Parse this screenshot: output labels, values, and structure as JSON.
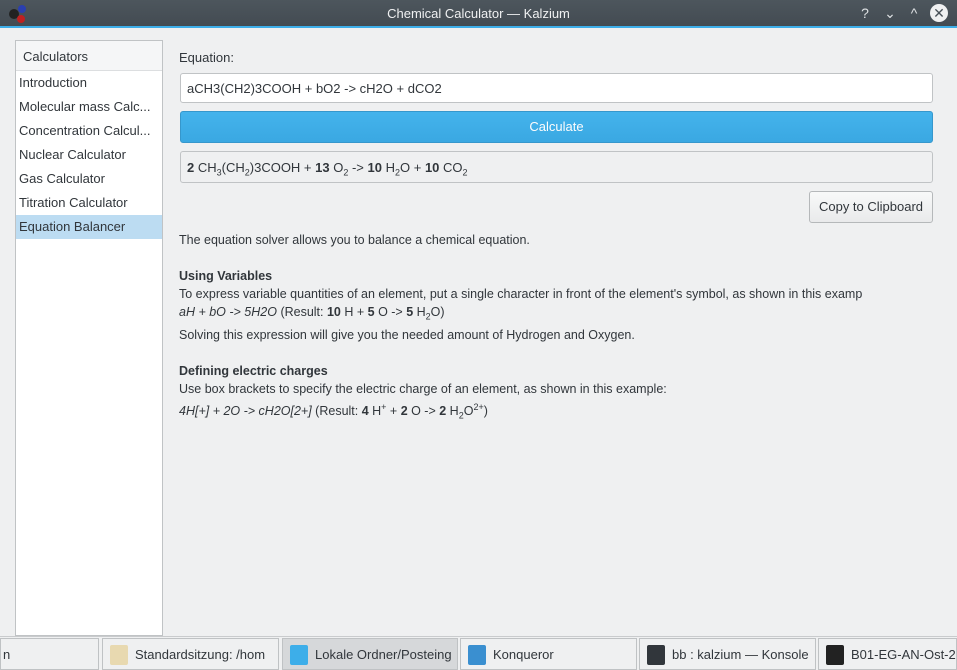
{
  "window": {
    "title": "Chemical Calculator — Kalzium",
    "buttons": [
      "?",
      "⌄",
      "^",
      "✕"
    ]
  },
  "sidebar": {
    "header": "Calculators",
    "items": [
      {
        "label": "Introduction"
      },
      {
        "label": "Molecular mass Calc..."
      },
      {
        "label": "Concentration Calcul..."
      },
      {
        "label": "Nuclear Calculator"
      },
      {
        "label": "Gas Calculator"
      },
      {
        "label": "Titration Calculator"
      },
      {
        "label": "Equation Balancer",
        "selected": true
      }
    ]
  },
  "main": {
    "equation_label": "Equation:",
    "equation_value": "aCH3(CH2)3COOH + bO2 -> cH2O + dCO2",
    "calculate_label": "Calculate",
    "result": [
      {
        "t": "2",
        "b": 1
      },
      {
        "t": " CH"
      },
      {
        "t": "3",
        "sub": 1
      },
      {
        "t": "(CH"
      },
      {
        "t": "2",
        "sub": 1
      },
      {
        "t": ")3COOH + "
      },
      {
        "t": "13",
        "b": 1
      },
      {
        "t": " O"
      },
      {
        "t": "2",
        "sub": 1
      },
      {
        "t": " -> "
      },
      {
        "t": "10",
        "b": 1
      },
      {
        "t": " H"
      },
      {
        "t": "2",
        "sub": 1
      },
      {
        "t": "O + "
      },
      {
        "t": "10",
        "b": 1
      },
      {
        "t": " CO"
      },
      {
        "t": "2",
        "sub": 1
      }
    ],
    "copy_label": "Copy to Clipboard",
    "help": [
      [
        {
          "t": "The equation solver allows you to balance a chemical equation."
        }
      ],
      null,
      [
        {
          "t": "Using Variables",
          "b": 1
        }
      ],
      [
        {
          "t": "To express variable quantities of an element, put a single character in front of the element's symbol, as shown in this examp"
        }
      ],
      [
        {
          "t": "aH + bO -> 5H2O",
          "i": 1
        },
        {
          "t": " (Result: "
        },
        {
          "t": "10",
          "b": 1
        },
        {
          "t": " H + "
        },
        {
          "t": "5",
          "b": 1
        },
        {
          "t": " O -> "
        },
        {
          "t": "5",
          "b": 1
        },
        {
          "t": " H"
        },
        {
          "t": "2",
          "sub": 1
        },
        {
          "t": "O)"
        }
      ],
      [
        {
          "t": "Solving this expression will give you the needed amount of Hydrogen and Oxygen."
        }
      ],
      null,
      [
        {
          "t": "Defining electric charges",
          "b": 1
        }
      ],
      [
        {
          "t": "Use box brackets to specify the electric charge of an element, as shown in this example:"
        }
      ],
      [
        {
          "t": "4H[+] + 2O -> cH2O[2+]",
          "i": 1
        },
        {
          "t": " (Result: "
        },
        {
          "t": "4",
          "b": 1
        },
        {
          "t": " H"
        },
        {
          "t": "+",
          "sup": 1
        },
        {
          "t": " + "
        },
        {
          "t": "2",
          "b": 1
        },
        {
          "t": " O -> "
        },
        {
          "t": "2",
          "b": 1
        },
        {
          "t": " H"
        },
        {
          "t": "2",
          "sub": 1
        },
        {
          "t": "O"
        },
        {
          "t": "2+",
          "sup": 1
        },
        {
          "t": ")"
        }
      ]
    ]
  },
  "taskbar": {
    "items": [
      {
        "label": "n",
        "icon": "none"
      },
      {
        "label": "Standardsitzung: /hom",
        "icon": "notes-icon"
      },
      {
        "label": "Lokale Ordner/Posteing",
        "icon": "mail-icon",
        "active": true
      },
      {
        "label": "Konqueror",
        "icon": "globe-icon"
      },
      {
        "label": "bb : kalzium — Konsole",
        "icon": "terminal-icon"
      },
      {
        "label": "B01-EG-AN-Ost-26",
        "icon": "document-icon"
      }
    ]
  },
  "colors": {
    "accent": "#3daee9",
    "selection": "#bcdcf2",
    "titlebar": "#475057"
  }
}
